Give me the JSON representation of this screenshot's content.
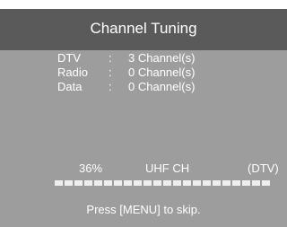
{
  "title": "Channel Tuning",
  "counts": [
    {
      "label": "DTV",
      "value": "3 Channel(s)"
    },
    {
      "label": "Radio",
      "value": "0 Channel(s)"
    },
    {
      "label": "Data",
      "value": "0 Channel(s)"
    }
  ],
  "separator": ":",
  "scan": {
    "percent": "36%",
    "band": "UHF CH",
    "type": "(DTV)",
    "progress_fraction": 0.36
  },
  "hint": "Press [MENU] to skip.",
  "colors": {
    "header": "#5a5a5a",
    "panel": "#9d9d9d",
    "text": "#ffffff"
  }
}
